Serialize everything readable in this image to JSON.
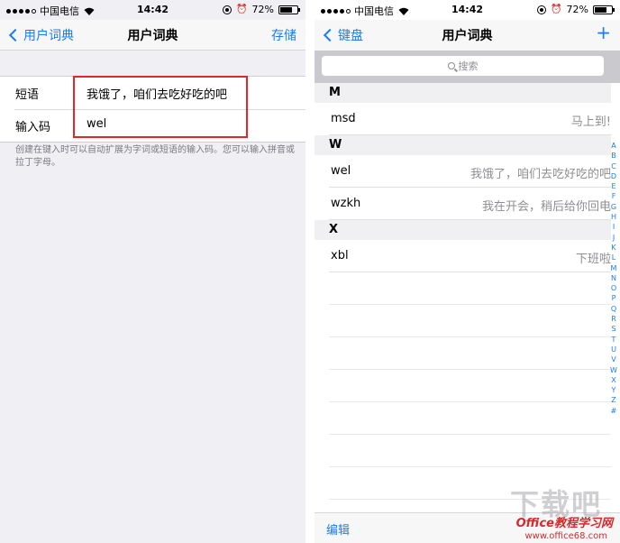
{
  "status_bar": {
    "carrier": "中国电信",
    "time": "14:42",
    "battery": "72%",
    "battery_level": 0.72
  },
  "left": {
    "nav": {
      "back_label": "用户词典",
      "title": "用户词典",
      "save_label": "存储"
    },
    "form": {
      "phrase_label": "短语",
      "phrase_value": "我饿了，咱们去吃好吃的吧",
      "shortcut_label": "输入码",
      "shortcut_value": "wel"
    },
    "hint": "创建在键入时可以自动扩展为字词或短语的输入码。您可以输入拼音或拉丁字母。",
    "highlight_color": "#e0282a"
  },
  "right": {
    "nav": {
      "back_label": "键盘",
      "title": "用户词典",
      "add_label": "+"
    },
    "search_placeholder": "搜索",
    "sections": [
      {
        "letter": "M",
        "entries": [
          {
            "shortcut": "msd",
            "phrase": "马上到!"
          }
        ]
      },
      {
        "letter": "W",
        "entries": [
          {
            "shortcut": "wel",
            "phrase": "我饿了，咱们去吃好吃的吧"
          },
          {
            "shortcut": "wzkh",
            "phrase": "我在开会，稍后给你回电"
          }
        ]
      },
      {
        "letter": "X",
        "entries": [
          {
            "shortcut": "xbl",
            "phrase": "下班啦"
          }
        ]
      }
    ],
    "index_letters": [
      "A",
      "B",
      "C",
      "D",
      "E",
      "F",
      "G",
      "H",
      "I",
      "J",
      "K",
      "L",
      "M",
      "N",
      "O",
      "P",
      "Q",
      "R",
      "S",
      "T",
      "U",
      "V",
      "W",
      "X",
      "Y",
      "Z",
      "#"
    ],
    "edit_label": "编辑"
  },
  "watermark": {
    "brand": "下载吧",
    "site_name": "Office教程学习网",
    "url": "www.office68.com"
  },
  "colors": {
    "accent": "#1a7cf6",
    "group_bg": "#efeff4"
  }
}
